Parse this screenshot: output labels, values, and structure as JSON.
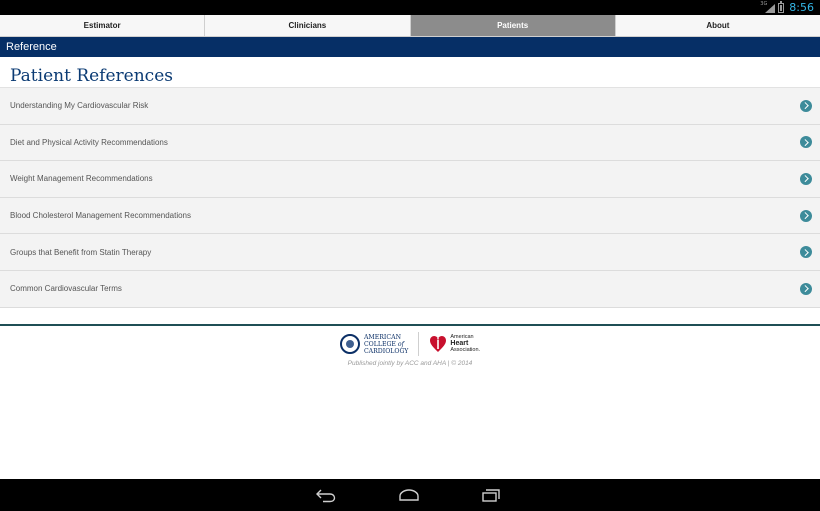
{
  "status_bar": {
    "network_label": "3G",
    "time": "8:56"
  },
  "tabs": [
    {
      "label": "Estimator",
      "active": false
    },
    {
      "label": "Clinicians",
      "active": false
    },
    {
      "label": "Patients",
      "active": true
    },
    {
      "label": "About",
      "active": false
    }
  ],
  "section_header": "Reference",
  "page_title": "Patient References",
  "references": [
    {
      "label": "Understanding My Cardiovascular Risk",
      "icon": "chevron-right-circle-icon"
    },
    {
      "label": "Diet and Physical Activity Recommendations",
      "icon": "chevron-right-circle-icon"
    },
    {
      "label": "Weight Management Recommendations",
      "icon": "chevron-right-circle-icon"
    },
    {
      "label": "Blood Cholesterol Management Recommendations",
      "icon": "chevron-right-circle-icon"
    },
    {
      "label": "Groups that Benefit from Statin Therapy",
      "icon": "chevron-right-circle-icon"
    },
    {
      "label": "Common Cardiovascular Terms",
      "icon": "chevron-right-circle-icon"
    }
  ],
  "footer": {
    "acc_logo": {
      "line1": "AMERICAN",
      "line2a": "COLLEGE",
      "line2b": "of",
      "line3": "CARDIOLOGY"
    },
    "aha_logo": {
      "line1": "American",
      "line2": "Heart",
      "line3": "Association."
    },
    "published": "Published jointly by ACC and AHA | © 2014"
  },
  "colors": {
    "header_blue": "#062f66",
    "title_blue": "#0a3a73",
    "active_tab": "#8c8c8c",
    "chevron_teal": "#3d8b9a",
    "clock_blue": "#33b5e5",
    "aha_red": "#c8102e"
  }
}
